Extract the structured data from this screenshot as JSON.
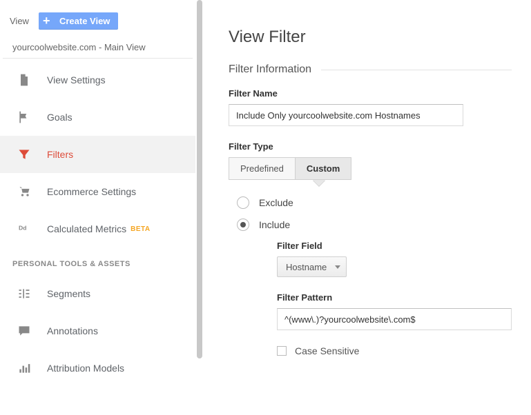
{
  "sidebar": {
    "view_label": "View",
    "create_view_label": "Create View",
    "breadcrumb": "yourcoolwebsite.com - Main View",
    "items": [
      {
        "label": "View Settings"
      },
      {
        "label": "Goals"
      },
      {
        "label": "Filters"
      },
      {
        "label": "Ecommerce Settings"
      },
      {
        "label": "Calculated Metrics",
        "badge": "BETA"
      }
    ],
    "section_title": "PERSONAL TOOLS & ASSETS",
    "personal_items": [
      {
        "label": "Segments"
      },
      {
        "label": "Annotations"
      },
      {
        "label": "Attribution Models"
      }
    ]
  },
  "main": {
    "title": "View Filter",
    "info_title": "Filter Information",
    "filter_name_label": "Filter Name",
    "filter_name_value": "Include Only yourcoolwebsite.com Hostnames",
    "filter_type_label": "Filter Type",
    "tabs": {
      "predefined": "Predefined",
      "custom": "Custom",
      "active": "custom"
    },
    "radio": {
      "exclude": "Exclude",
      "include": "Include",
      "selected": "include"
    },
    "filter_field_label": "Filter Field",
    "filter_field_value": "Hostname",
    "filter_pattern_label": "Filter Pattern",
    "filter_pattern_value": "^(www\\.)?yourcoolwebsite\\.com$",
    "case_sensitive_label": "Case Sensitive",
    "case_sensitive_checked": false
  }
}
